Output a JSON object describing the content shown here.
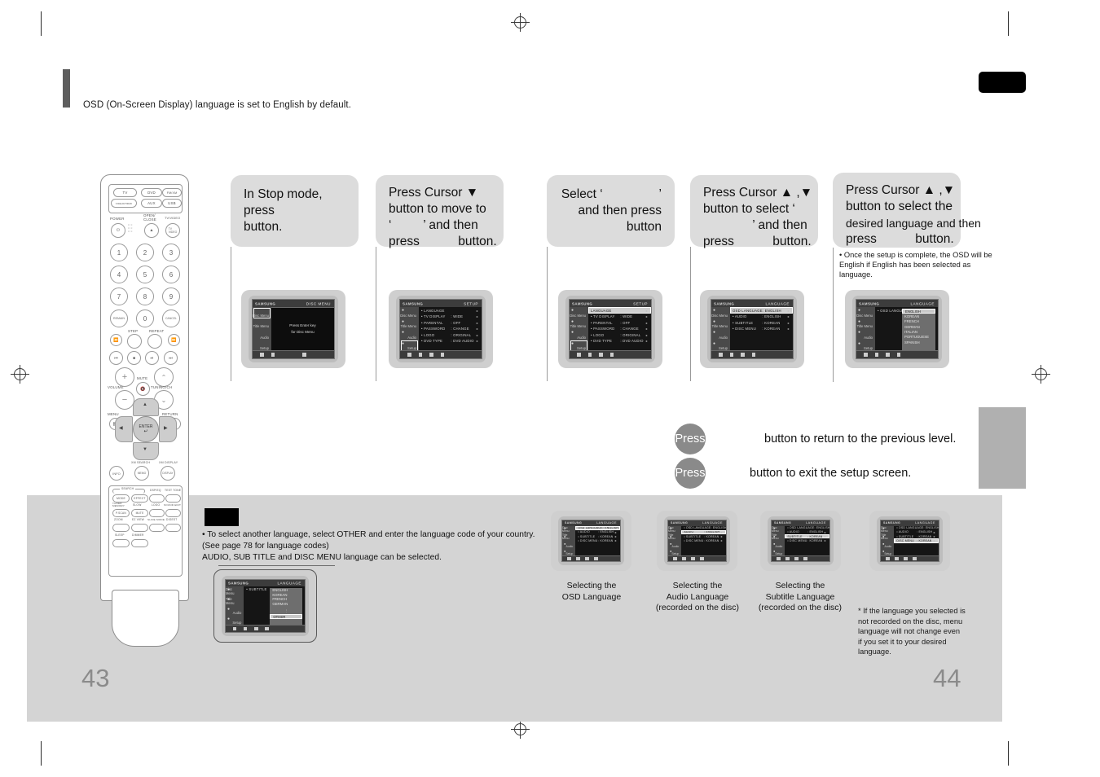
{
  "document": {
    "intro": "OSD (On-Screen Display) language is set to English by default.",
    "page_left": "43",
    "page_right": "44"
  },
  "steps": [
    {
      "id": "step-1",
      "lines": [
        "In Stop mode,",
        "press",
        "button."
      ],
      "has_blank_button_name": true
    },
    {
      "id": "step-2",
      "lines": [
        "Press Cursor ▼",
        "button to move to",
        "‘         ’ and then",
        "press           button."
      ],
      "has_blank_button_name": true
    },
    {
      "id": "step-3",
      "lines": [
        "Select ‘                ’",
        "and then press",
        "            button"
      ],
      "has_blank_button_name": true
    },
    {
      "id": "step-4",
      "lines": [
        "Press Cursor ▲ ,▼",
        "button to select ‘",
        "              ’ and then",
        "press           button."
      ],
      "has_blank_button_name": true
    },
    {
      "id": "step-5",
      "lines": [
        "Press Cursor ▲ ,▼",
        "button to select the",
        "desired language and then",
        "press           button."
      ],
      "has_blank_button_name": true
    }
  ],
  "step5_note": "• Once the setup is complete, the OSD will be\n   English if English has been selected as language.",
  "press_rows": [
    {
      "label": "Press",
      "text": "button to return to the previous level."
    },
    {
      "label": "Press",
      "text": "button to exit the setup screen."
    }
  ],
  "bottom_note": {
    "lines": [
      "• To select another language, select OTHER and enter the language code of your country.",
      "  (See page 78 for language codes)",
      "  AUDIO, SUB TITLE and DISC MENU language can be selected."
    ]
  },
  "footnote": "* If the language you selected is\n   not recorded on the disc, menu\n   language will not change even\n   if you set it to your desired\n   language.",
  "osd": {
    "logo": "SAMSUNG",
    "sidebar": [
      {
        "label": "Disc Menu",
        "icon": "disc-menu-icon"
      },
      {
        "label": "Title Menu",
        "icon": "title-menu-icon"
      },
      {
        "label": "Audio",
        "icon": "speaker-icon"
      },
      {
        "label": "Setup",
        "icon": "gear-icon"
      }
    ]
  },
  "screens": [
    {
      "id": "screen-disc-menu",
      "title": "DISC MENU",
      "sidebar_selected": 0,
      "center_lines": [
        "Press Enter key",
        "for Disc Menu"
      ],
      "rows": []
    },
    {
      "id": "screen-setup",
      "title": "SETUP",
      "sidebar_selected": 3,
      "rows": [
        {
          "label": "LANGUAGE",
          "value": "",
          "sel": false
        },
        {
          "label": "TV  DISPLAY",
          "value": ": WIDE",
          "sel": false
        },
        {
          "label": "PARENTAL",
          "value": ": OFF",
          "sel": false
        },
        {
          "label": "PASSWORD",
          "value": ": CHANGE",
          "sel": false
        },
        {
          "label": "LOGO",
          "value": ": ORIGINAL",
          "sel": false
        },
        {
          "label": "DVD TYPE",
          "value": ": DVD AUDIO",
          "sel": false
        }
      ]
    },
    {
      "id": "screen-setup-language-highlight",
      "title": "SETUP",
      "sidebar_selected": 3,
      "rows": [
        {
          "label": "LANGUAGE",
          "value": "",
          "sel": true
        },
        {
          "label": "TV  DISPLAY",
          "value": ": WIDE",
          "sel": false
        },
        {
          "label": "PARENTAL",
          "value": ": OFF",
          "sel": false
        },
        {
          "label": "PASSWORD",
          "value": ": CHANGE",
          "sel": false
        },
        {
          "label": "LOGO",
          "value": ": ORIGINAL",
          "sel": false
        },
        {
          "label": "DVD TYPE",
          "value": ": DVD AUDIO",
          "sel": false
        }
      ]
    },
    {
      "id": "screen-language-osd-selected",
      "title": "LANGUAGE",
      "sidebar_selected": -1,
      "rows": [
        {
          "label": "OSD LANGUAGE",
          "value": ": ENGLISH",
          "sel": true
        },
        {
          "label": "AUDIO",
          "value": ": ENGLISH",
          "sel": false
        },
        {
          "label": "SUBTITLE",
          "value": ": KOREAN",
          "sel": false
        },
        {
          "label": "DISC MENU",
          "value": ": KOREAN",
          "sel": false
        }
      ]
    },
    {
      "id": "screen-language-dropdown",
      "title": "LANGUAGE",
      "sidebar_selected": -1,
      "rows": [
        {
          "label": "OSD LANGUAGE",
          "value": "",
          "sel": false
        }
      ],
      "dropdown": {
        "items": [
          "ENGLISH",
          "KOREAN",
          "FRENCH",
          "GERMAN",
          "ITALIAN",
          "PORTUGUESE",
          "SPANISH"
        ],
        "selected": 0
      }
    }
  ],
  "bottom_screen": {
    "id": "screen-subtitle-other",
    "title": "LANGUAGE",
    "rows": [
      {
        "label": "SUBTITLE",
        "value": "",
        "sel": false
      }
    ],
    "dropdown": {
      "items": [
        "ENGLISH",
        "KOREAN",
        "FRENCH",
        "GERMAN"
      ],
      "tail": "OTHER",
      "selected_tail": true
    }
  },
  "small_screens": [
    {
      "id": "screen-select-osd",
      "title": "LANGUAGE",
      "caption": "Selecting the\nOSD Language",
      "rows": [
        {
          "label": "OSD LANGUAGE",
          "value": ": ENGLISH",
          "sel": true
        },
        {
          "label": "AUDIO",
          "value": ": ENGLISH",
          "sel": false
        },
        {
          "label": "SUBTITLE",
          "value": ": KOREAN",
          "sel": false
        },
        {
          "label": "DISC MENU",
          "value": ": KOREAN",
          "sel": false
        }
      ]
    },
    {
      "id": "screen-select-audio",
      "title": "LANGUAGE",
      "caption": "Selecting the\nAudio Language\n(recorded on the disc)",
      "rows": [
        {
          "label": "OSD LANGUAGE",
          "value": ": ENGLISH",
          "sel": false
        },
        {
          "label": "AUDIO",
          "value": ": ENGLISH",
          "sel": true
        },
        {
          "label": "SUBTITLE",
          "value": ": KOREAN",
          "sel": false
        },
        {
          "label": "DISC MENU",
          "value": ": KOREAN",
          "sel": false
        }
      ]
    },
    {
      "id": "screen-select-subtitle",
      "title": "LANGUAGE",
      "caption": "Selecting the\nSubtitle Language\n(recorded on the disc)",
      "rows": [
        {
          "label": "OSD LANGUAGE",
          "value": ": ENGLISH",
          "sel": false
        },
        {
          "label": "AUDIO",
          "value": ": ENGLISH",
          "sel": false
        },
        {
          "label": "SUBTITLE",
          "value": ": KOREAN",
          "sel": true
        },
        {
          "label": "DISC MENU",
          "value": ": KOREAN",
          "sel": false
        }
      ]
    },
    {
      "id": "screen-select-disc-menu",
      "title": "LANGUAGE",
      "caption": "",
      "rows": [
        {
          "label": "OSD LANGUAGE",
          "value": ": ENGLISH",
          "sel": false
        },
        {
          "label": "AUDIO",
          "value": ": ENGLISH",
          "sel": false
        },
        {
          "label": "SUBTITLE",
          "value": ": KOREAN",
          "sel": false
        },
        {
          "label": "DISC MENU",
          "value": ": KOREAN",
          "sel": true
        }
      ]
    }
  ],
  "remote": {
    "source_buttons": [
      "TV",
      "DVD",
      "FM/XM",
      "VIDEO/HDMI",
      "AUX",
      "USB"
    ],
    "labels_top": [
      "POWER",
      "OPEN/\nCLOSE",
      "TV/VIDEO"
    ],
    "numbers": [
      "1",
      "2",
      "3",
      "4",
      "5",
      "6",
      "7",
      "8",
      "9",
      "0"
    ],
    "num_side": [
      "REMAIN",
      "CANCEL"
    ],
    "transport_labels": [
      "STEP",
      "REPEAT"
    ],
    "volume": {
      "left": "VOLUME",
      "mute": "MUTE",
      "right": "TUNING/CH"
    },
    "menu": "MENU",
    "return": "RETURN",
    "enter": "ENTER",
    "info": "INFO",
    "search_labels": [
      "XM SEARCH",
      "XM DISPLAY"
    ],
    "search_buttons": [
      "MEMO",
      "DISPLAY"
    ],
    "grid_labels": [
      [
        "MODE",
        "EFFECT",
        "DSP/EQ",
        "TEST TONE"
      ],
      [
        "TUNER\nMEMORY",
        "SLOW",
        "LOGO",
        "SOUND EDIT"
      ],
      [
        "ZOOM",
        "EZ VIEW",
        "SLIDE MODE",
        "DIGEST"
      ],
      [
        "SLEEP",
        "DIMMER"
      ]
    ],
    "grid_group_label": "SEARCH",
    "pscan": "P.SCAN",
    "mute_label": "MUTE"
  }
}
